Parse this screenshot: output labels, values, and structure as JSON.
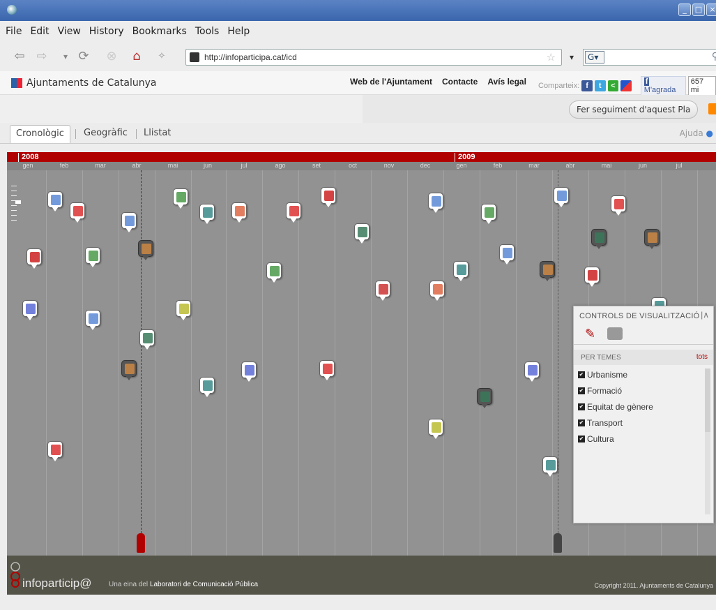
{
  "menu": [
    "File",
    "Edit",
    "View",
    "History",
    "Bookmarks",
    "Tools",
    "Help"
  ],
  "url": "http://infoparticipa.cat/icd",
  "search": {
    "engine": "G"
  },
  "site": {
    "title": "Ajuntaments de Catalunya",
    "links": [
      "Web de l'Ajuntament",
      "Contacte",
      "Avís legal"
    ],
    "share_label": "Comparteix:",
    "like_label": "M'agrada",
    "like_count": "657 mi"
  },
  "follow_button": "Fer seguiment d'aquest Pla",
  "tabs": [
    "Cronològic",
    "Geogràfic",
    "Llistat"
  ],
  "help": "Ajuda",
  "timeline": {
    "years": [
      {
        "label": "2008"
      },
      {
        "label": "2009"
      }
    ],
    "months": [
      "gen",
      "feb",
      "mar",
      "abr",
      "mai",
      "jun",
      "jul",
      "ago",
      "set",
      "oct",
      "nov",
      "dec",
      "gen",
      "feb",
      "mar",
      "abr",
      "mai",
      "jun",
      "jul"
    ],
    "document_markers": [
      {
        "type": "doc",
        "style": "light"
      },
      {
        "type": "pdf",
        "style": "light"
      },
      {
        "type": "doc",
        "style": "light"
      },
      {
        "type": "image",
        "style": "light"
      },
      {
        "type": "globe",
        "style": "light"
      },
      {
        "type": "ppt",
        "style": "light"
      },
      {
        "type": "pdf",
        "style": "light"
      },
      {
        "type": "calendar",
        "style": "light"
      },
      {
        "type": "doc",
        "style": "light"
      },
      {
        "type": "image",
        "style": "light"
      },
      {
        "type": "doc",
        "style": "light"
      },
      {
        "type": "pdf",
        "style": "light"
      },
      {
        "type": "film",
        "style": "light"
      },
      {
        "type": "calendar",
        "style": "light"
      },
      {
        "type": "image",
        "style": "light"
      },
      {
        "type": "people",
        "style": "dark"
      },
      {
        "type": "image",
        "style": "light"
      },
      {
        "type": "film",
        "style": "dark"
      },
      {
        "type": "people",
        "style": "dark"
      },
      {
        "type": "doc",
        "style": "light"
      },
      {
        "type": "globe",
        "style": "light"
      },
      {
        "type": "people",
        "style": "dark"
      },
      {
        "type": "calendar",
        "style": "light"
      },
      {
        "type": "chart",
        "style": "light"
      },
      {
        "type": "doc",
        "style": "light"
      },
      {
        "type": "note",
        "style": "light"
      },
      {
        "type": "audio",
        "style": "light"
      },
      {
        "type": "ppt",
        "style": "light"
      },
      {
        "type": "globe",
        "style": "light"
      },
      {
        "type": "film",
        "style": "light"
      },
      {
        "type": "people",
        "style": "dark"
      },
      {
        "type": "chart",
        "style": "light"
      },
      {
        "type": "globe",
        "style": "light"
      },
      {
        "type": "pdf",
        "style": "light"
      },
      {
        "type": "chart",
        "style": "light"
      },
      {
        "type": "film",
        "style": "dark"
      },
      {
        "type": "note",
        "style": "light"
      },
      {
        "type": "pdf",
        "style": "light"
      },
      {
        "type": "globe",
        "style": "light"
      },
      {
        "type": "chart",
        "style": "light"
      },
      {
        "type": "globe",
        "style": "light"
      }
    ]
  },
  "controls": {
    "title": "CONTROLS DE VISUALITZACIÓ",
    "section": "PER TEMES",
    "all": "tots",
    "themes": [
      "Urbanisme",
      "Formació",
      "Equitat de gènere",
      "Transport",
      "Cultura"
    ]
  },
  "footer": {
    "brand": "infoparticip@",
    "tagline_pre": "Una eina del",
    "tagline_org": "Laboratori de Comunicació Pública",
    "copyright": "Copyright 2011. Ajuntaments de Catalunya"
  },
  "colors": {
    "accent": "#b10000",
    "timeline_bg": "#929292",
    "footer_bg": "#555449"
  }
}
